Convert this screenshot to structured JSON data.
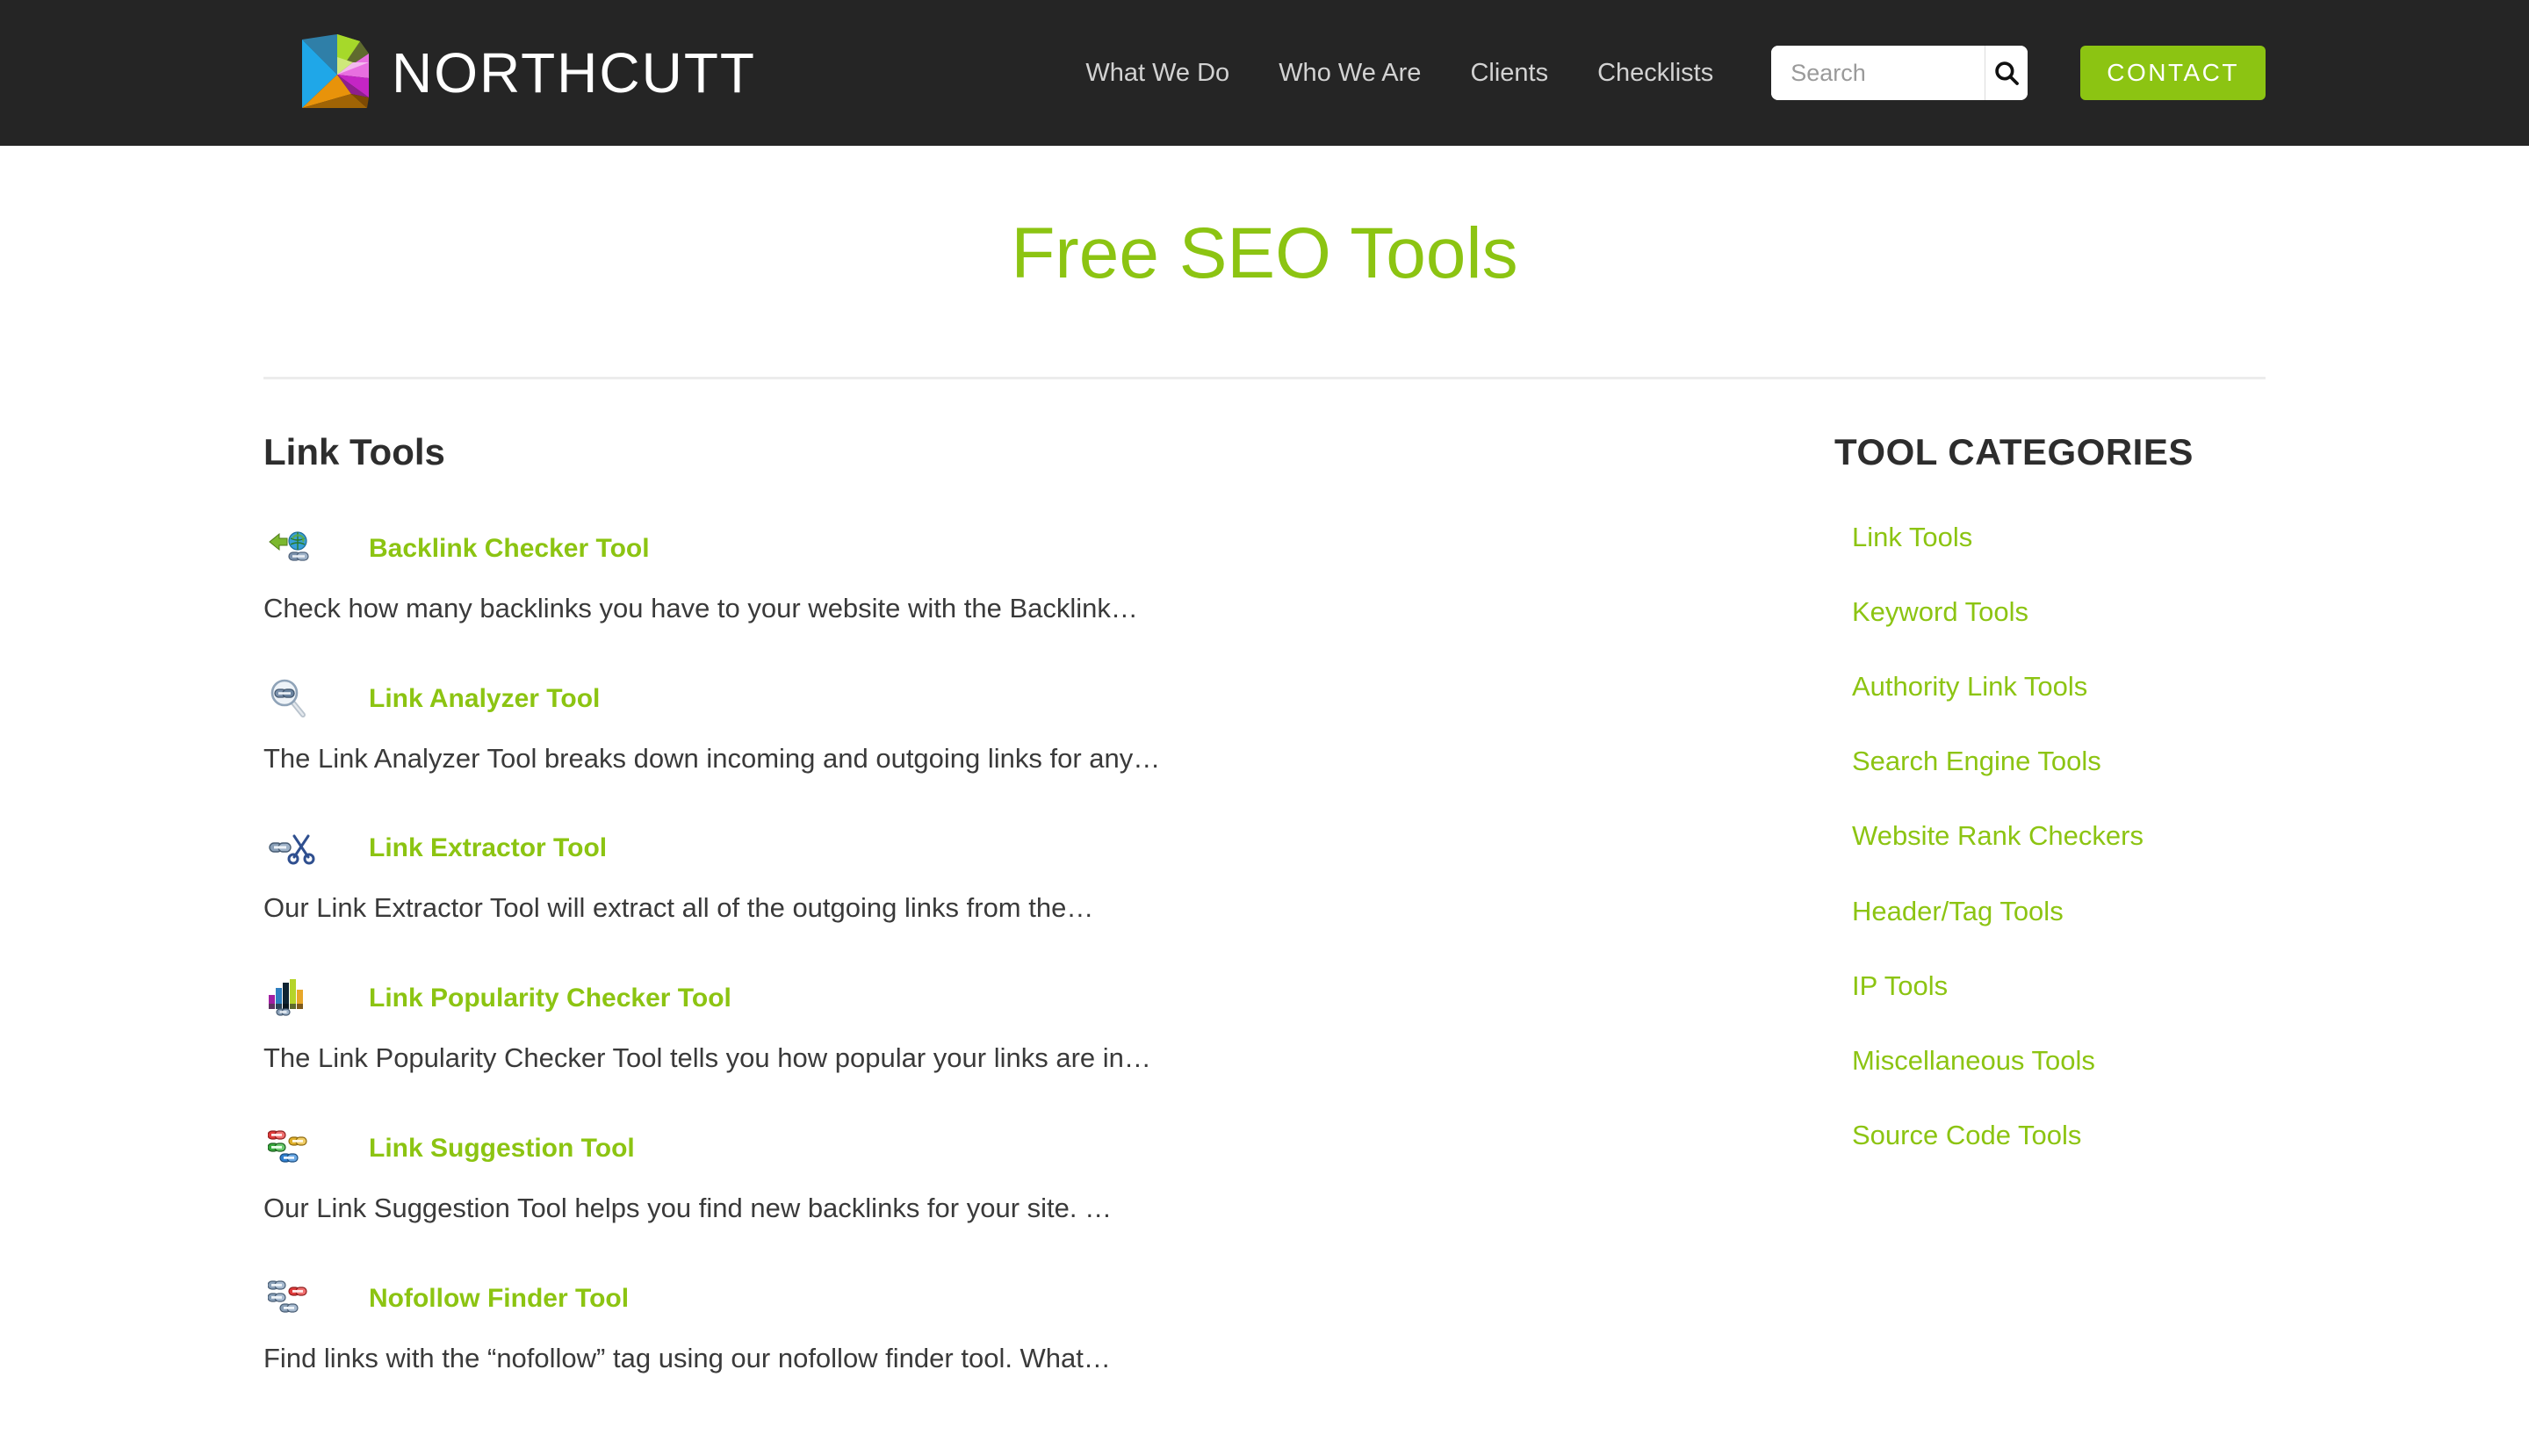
{
  "header": {
    "brand_name": "NORTHCUTT",
    "logo_icon": "prism-logo-icon",
    "nav": [
      {
        "label": "What We Do"
      },
      {
        "label": "Who We Are"
      },
      {
        "label": "Clients"
      },
      {
        "label": "Checklists"
      }
    ],
    "search": {
      "placeholder": "Search",
      "value": "",
      "button_icon": "search-icon"
    },
    "contact_label": "CONTACT",
    "accent_color": "#8cc412",
    "background_color": "#252525"
  },
  "page": {
    "title": "Free SEO Tools",
    "title_color": "#8cc412"
  },
  "main": {
    "heading": "Link Tools",
    "tools": [
      {
        "icon": "backlink-arrow-globe-icon",
        "title": "Backlink Checker Tool",
        "description": "Check how many backlinks you have to your website with the Backlink…"
      },
      {
        "icon": "magnifier-link-icon",
        "title": "Link Analyzer Tool",
        "description": "The Link Analyzer Tool breaks down incoming and outgoing links for any…"
      },
      {
        "icon": "chain-scissors-icon",
        "title": "Link Extractor Tool",
        "description": "Our Link Extractor Tool will extract all of the outgoing links from the…"
      },
      {
        "icon": "bar-chart-link-icon",
        "title": "Link Popularity Checker Tool",
        "description": "The Link Popularity Checker Tool tells you how popular your links are in…"
      },
      {
        "icon": "colored-chain-links-icon",
        "title": "Link Suggestion Tool",
        "description": "Our Link Suggestion Tool helps you find new backlinks for your site. …"
      },
      {
        "icon": "gray-chain-links-icon",
        "title": "Nofollow Finder Tool",
        "description": "Find links with the “nofollow” tag using our nofollow finder tool. What…"
      }
    ]
  },
  "sidebar": {
    "heading": "TOOL CATEGORIES",
    "categories": [
      {
        "label": "Link Tools"
      },
      {
        "label": "Keyword Tools"
      },
      {
        "label": "Authority Link Tools"
      },
      {
        "label": "Search Engine Tools"
      },
      {
        "label": "Website Rank Checkers"
      },
      {
        "label": "Header/Tag Tools"
      },
      {
        "label": "IP Tools"
      },
      {
        "label": "Miscellaneous Tools"
      },
      {
        "label": "Source Code Tools"
      }
    ]
  }
}
